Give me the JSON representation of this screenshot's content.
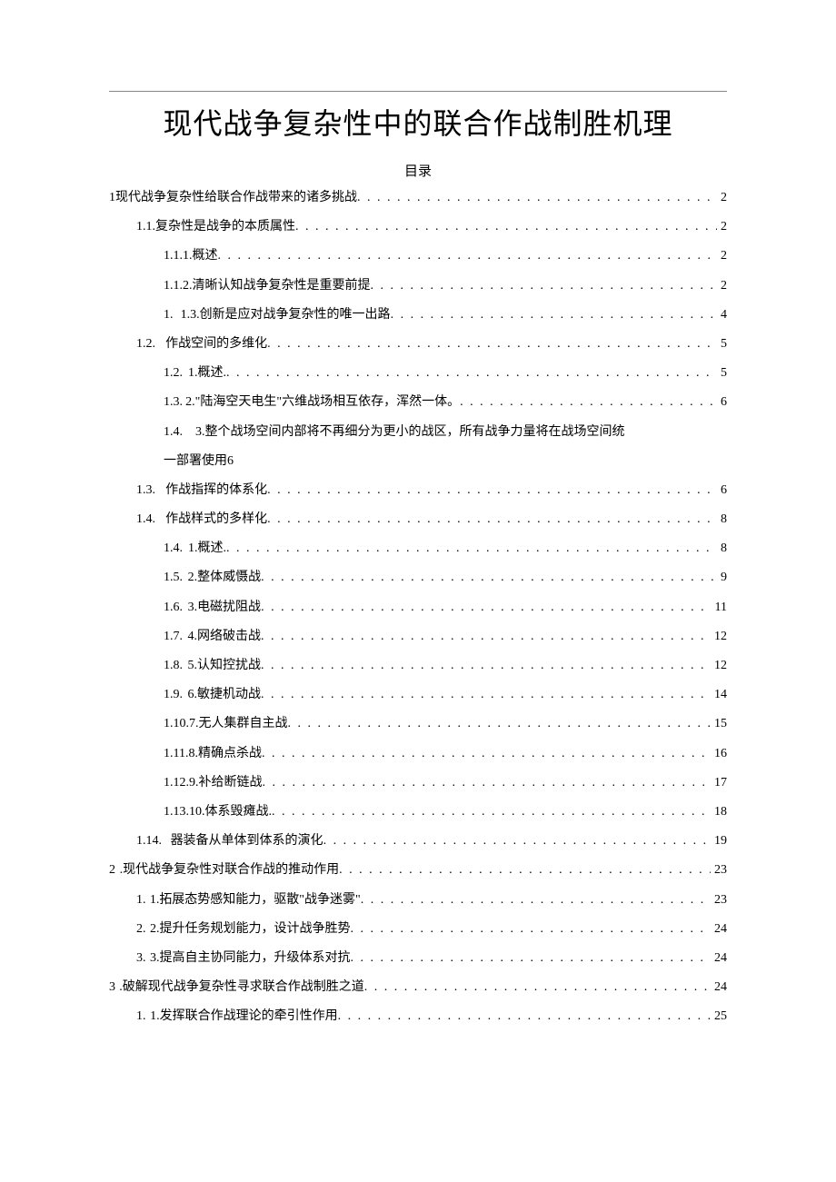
{
  "title": "现代战争复杂性中的联合作战制胜机理",
  "toc_label": "目录",
  "entries": [
    {
      "lvl": 0,
      "num": "1",
      "txt": "现代战争复杂性给联合作战带来的诸多挑战",
      "pg": "2",
      "gap": ""
    },
    {
      "lvl": 1,
      "num": "1.1.",
      "txt": "复杂性是战争的本质属性",
      "pg": "2",
      "gap": ""
    },
    {
      "lvl": 2,
      "num": "1.1.1.",
      "txt": "概述",
      "pg": "2",
      "gap": ""
    },
    {
      "lvl": 2,
      "num": "1.1.2.",
      "txt": "清晰认知战争复杂性是重要前提",
      "pg": "2",
      "gap": ""
    },
    {
      "lvl": 2,
      "num": "1.",
      "txt": "1.3.创新是应对战争复杂性的唯一出路",
      "pg": "4",
      "gap": "g"
    },
    {
      "lvl": 1,
      "num": "1.2.",
      "txt": "作战空间的多维化",
      "pg": "5",
      "gap": "g"
    },
    {
      "lvl": 2,
      "num": "1.2.",
      "txt": "1.概述.",
      "pg": "5",
      "gap": "s"
    },
    {
      "lvl": 2,
      "num": "1.3.",
      "txt": "2.\"陆海空天电生\"六维战场相互依存，浑然一体。",
      "pg": "6",
      "gap": "s"
    },
    {
      "lvl": 2,
      "num": "1.4.",
      "txt": "3.整个战场空间内部将不再细分为更小的战区，所有战争力量将在战场空间统",
      "pg": "",
      "gap": "s",
      "noleader": true
    },
    {
      "lvl": 2,
      "num": "",
      "txt": "一部署使用",
      "pg": "6",
      "gap": "",
      "cont": true
    },
    {
      "lvl": 1,
      "num": "1.3.",
      "txt": "作战指挥的体系化",
      "pg": "6",
      "gap": "g"
    },
    {
      "lvl": 1,
      "num": "1.4.",
      "txt": "作战样式的多样化",
      "pg": "8",
      "gap": "g"
    },
    {
      "lvl": 2,
      "num": "1.4.",
      "txt": "1.概述.",
      "pg": "8",
      "gap": "s"
    },
    {
      "lvl": 2,
      "num": "1.5.",
      "txt": "2.整体威慑战",
      "pg": "9",
      "gap": "s"
    },
    {
      "lvl": 2,
      "num": "1.6.",
      "txt": "3.电磁扰阻战",
      "pg": "11",
      "gap": "s"
    },
    {
      "lvl": 2,
      "num": "1.7.",
      "txt": "4.网络破击战",
      "pg": "12",
      "gap": "s"
    },
    {
      "lvl": 2,
      "num": "1.8.",
      "txt": "5.认知控扰战",
      "pg": "12",
      "gap": "s"
    },
    {
      "lvl": 2,
      "num": "1.9.",
      "txt": "6.敏捷机动战",
      "pg": "14",
      "gap": "s"
    },
    {
      "lvl": 2,
      "num": "1.10.",
      "txt": "7.无人集群自主战",
      "pg": "15",
      "gap": ""
    },
    {
      "lvl": 2,
      "num": "1.11.",
      "txt": "8.精确点杀战",
      "pg": "16",
      "gap": ""
    },
    {
      "lvl": 2,
      "num": "1.12.",
      "txt": "9.补给断链战",
      "pg": "17",
      "gap": ""
    },
    {
      "lvl": 2,
      "num": "1.13.",
      "txt": "10.体系毁瘫战.",
      "pg": "18",
      "gap": ""
    },
    {
      "lvl": 1,
      "num": "1.14.",
      "txt": "器装备从单体到体系的演化",
      "pg": "19",
      "gap": "g"
    },
    {
      "lvl": 0,
      "num": "2",
      "txt": ".现代战争复杂性对联合作战的推动作用",
      "pg": "23",
      "gap": "s"
    },
    {
      "lvl": 1,
      "num": "1.",
      "txt": "1.拓展态势感知能力，驱散\"战争迷雾\"",
      "pg": "23",
      "gap": "s"
    },
    {
      "lvl": 1,
      "num": "2.",
      "txt": "2.提升任务规划能力，设计战争胜势",
      "pg": "24",
      "gap": "s"
    },
    {
      "lvl": 1,
      "num": "3.",
      "txt": "3.提高自主协同能力，升级体系对抗",
      "pg": "24",
      "gap": "s"
    },
    {
      "lvl": 0,
      "num": "3",
      "txt": ".破解现代战争复杂性寻求联合作战制胜之道",
      "pg": "24",
      "gap": "s"
    },
    {
      "lvl": 1,
      "num": "1.",
      "txt": "1.发挥联合作战理论的牵引性作用",
      "pg": "25",
      "gap": "s"
    }
  ]
}
